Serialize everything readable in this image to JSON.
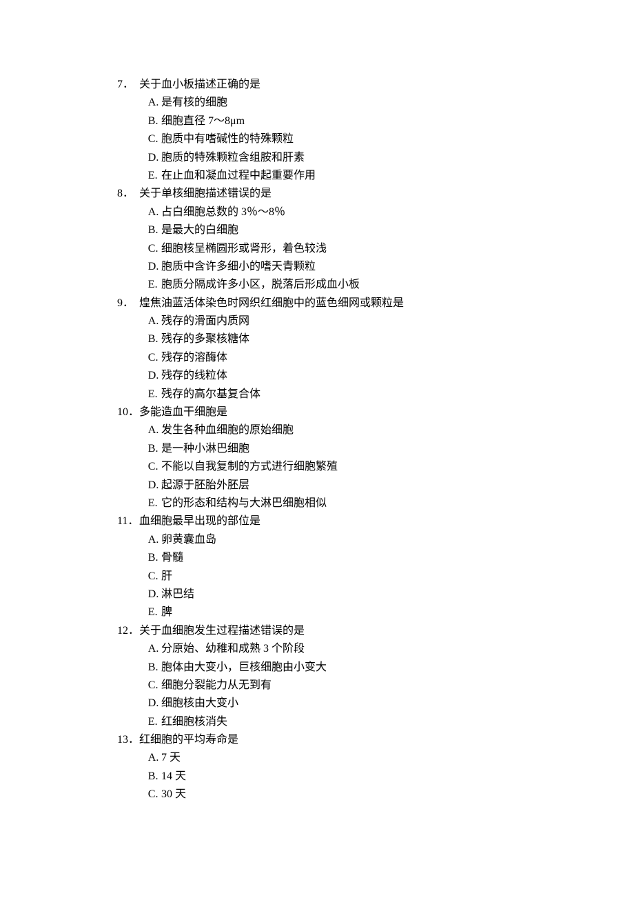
{
  "questions": [
    {
      "number": "7．",
      "stem": "关于血小板描述正确的是",
      "options": [
        {
          "letter": "A.",
          "text": "是有核的细胞"
        },
        {
          "letter": "B.",
          "text": "细胞直径 7～8μm"
        },
        {
          "letter": "C.",
          "text": "胞质中有嗜碱性的特殊颗粒"
        },
        {
          "letter": "D.",
          "text": "胞质的特殊颗粒含组胺和肝素"
        },
        {
          "letter": "E.",
          "text": "在止血和凝血过程中起重要作用"
        }
      ]
    },
    {
      "number": "8．",
      "stem": "关于单核细胞描述错误的是",
      "options": [
        {
          "letter": "A.",
          "text": "占白细胞总数的 3％～8％"
        },
        {
          "letter": "B.",
          "text": "是最大的白细胞"
        },
        {
          "letter": "C.",
          "text": "细胞核呈椭圆形或肾形，着色较浅"
        },
        {
          "letter": "D.",
          "text": "胞质中含许多细小的嗜天青颗粒"
        },
        {
          "letter": "E.",
          "text": "胞质分隔成许多小区，脱落后形成血小板"
        }
      ]
    },
    {
      "number": "9．",
      "stem": "煌焦油蓝活体染色时网织红细胞中的蓝色细网或颗粒是",
      "options": [
        {
          "letter": "A.",
          "text": "残存的滑面内质网"
        },
        {
          "letter": "B.",
          "text": "残存的多聚核糖体"
        },
        {
          "letter": "C.",
          "text": "残存的溶酶体"
        },
        {
          "letter": "D.",
          "text": "残存的线粒体"
        },
        {
          "letter": "E.",
          "text": "残存的高尔基复合体"
        }
      ]
    },
    {
      "number": "10．",
      "stem": "多能造血干细胞是",
      "options": [
        {
          "letter": "A.",
          "text": "发生各种血细胞的原始细胞"
        },
        {
          "letter": "B.",
          "text": "是一种小淋巴细胞"
        },
        {
          "letter": "C.",
          "text": "不能以自我复制的方式进行细胞繁殖"
        },
        {
          "letter": "D.",
          "text": "起源于胚胎外胚层"
        },
        {
          "letter": "E.",
          "text": "它的形态和结构与大淋巴细胞相似"
        }
      ]
    },
    {
      "number": "11．",
      "stem": "血细胞最早出现的部位是",
      "options": [
        {
          "letter": "A.",
          "text": "卵黄囊血岛"
        },
        {
          "letter": "B.",
          "text": "骨髓"
        },
        {
          "letter": "C.",
          "text": "肝"
        },
        {
          "letter": "D.",
          "text": "淋巴结"
        },
        {
          "letter": "E.",
          "text": "脾"
        }
      ]
    },
    {
      "number": "12．",
      "stem": "关于血细胞发生过程描述错误的是",
      "options": [
        {
          "letter": "A.",
          "text": "分原始、幼稚和成熟 3 个阶段"
        },
        {
          "letter": "B.",
          "text": "胞体由大变小，巨核细胞由小变大"
        },
        {
          "letter": "C.",
          "text": "细胞分裂能力从无到有"
        },
        {
          "letter": "D.",
          "text": "细胞核由大变小"
        },
        {
          "letter": "E.",
          "text": "红细胞核消失"
        }
      ]
    },
    {
      "number": "13．",
      "stem": "红细胞的平均寿命是",
      "options": [
        {
          "letter": "A.",
          "text": "7 天"
        },
        {
          "letter": "B.",
          "text": "14 天"
        },
        {
          "letter": "C.",
          "text": "30 天"
        }
      ]
    }
  ]
}
